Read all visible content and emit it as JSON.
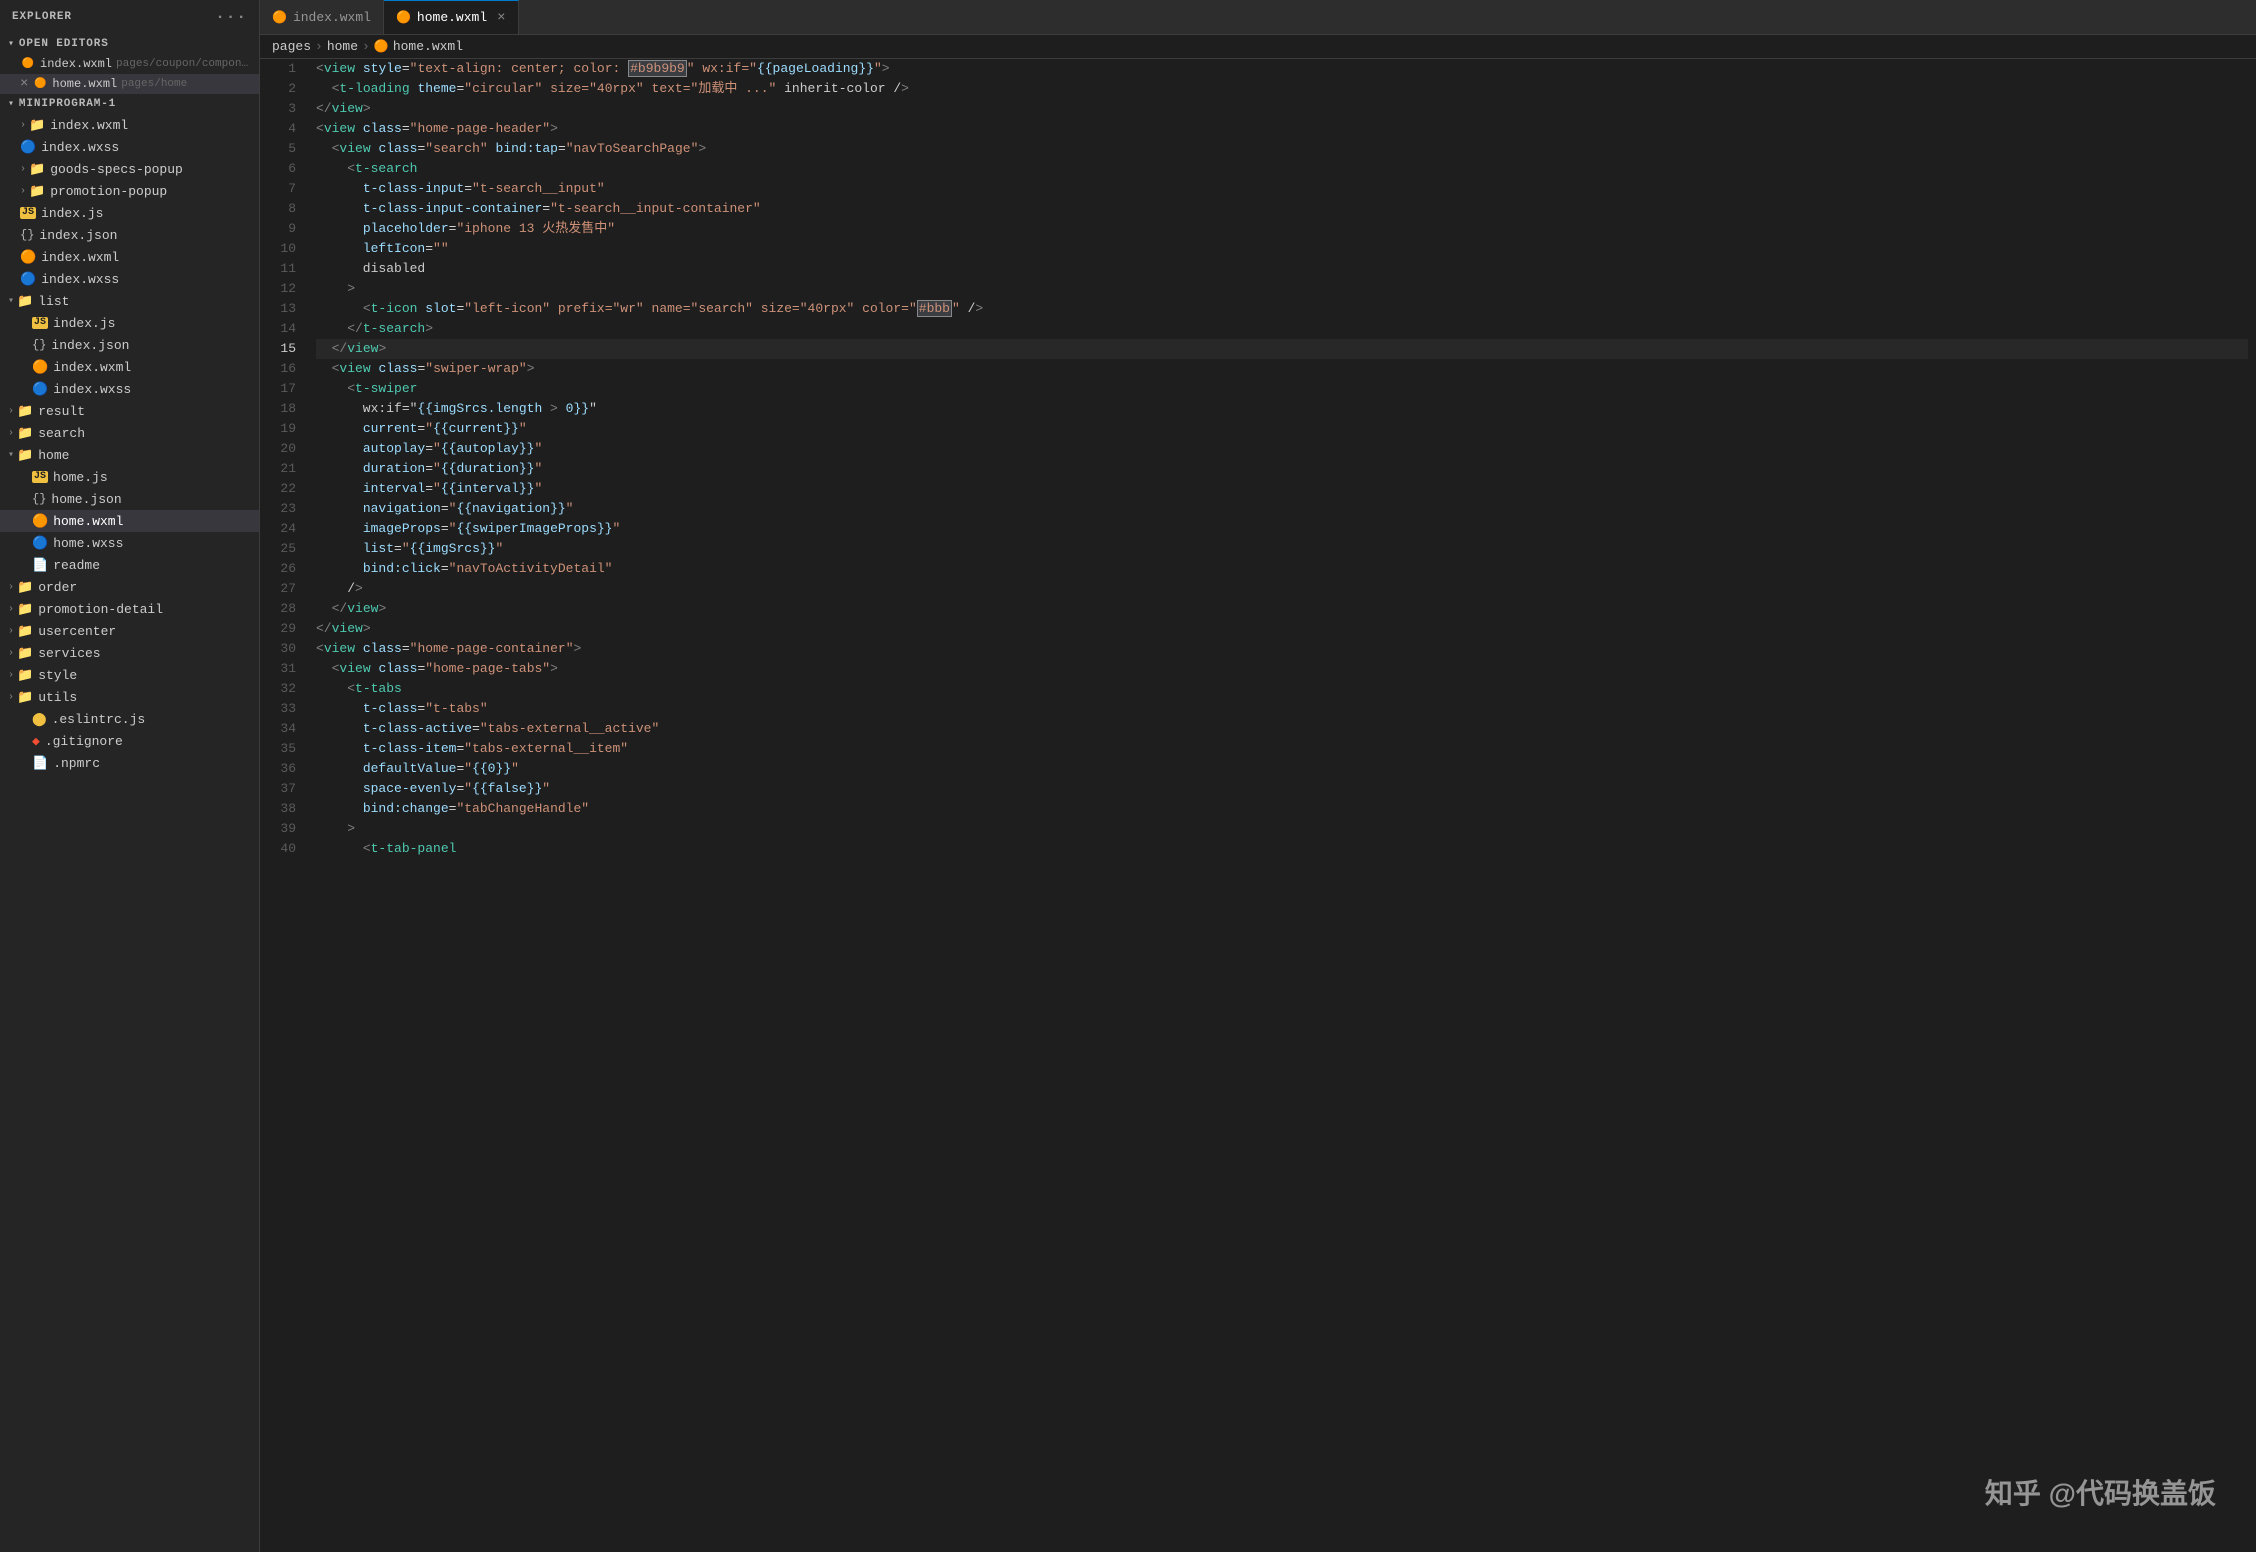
{
  "sidebar": {
    "title": "EXPLORER",
    "open_editors_label": "OPEN EDITORS",
    "project_label": "MINIPROGRAM-1",
    "open_editors": [
      {
        "name": "index.wxml",
        "path": "pages/coupon/components/floa...",
        "icon": "wxml",
        "active": false
      },
      {
        "name": "home.wxml",
        "path": "pages/home",
        "icon": "wxml",
        "active": true,
        "closeable": true
      }
    ],
    "tree": [
      {
        "indent": 0,
        "type": "folder",
        "label": "index.wxml",
        "expanded": false,
        "level": 1
      },
      {
        "indent": 0,
        "type": "file-wxss",
        "label": "index.wxss",
        "level": 1
      },
      {
        "indent": 0,
        "type": "folder",
        "label": "goods-specs-popup",
        "expanded": false,
        "level": 1
      },
      {
        "indent": 0,
        "type": "folder",
        "label": "promotion-popup",
        "expanded": false,
        "level": 1
      },
      {
        "indent": 0,
        "type": "file-js",
        "label": "index.js",
        "level": 1
      },
      {
        "indent": 0,
        "type": "file-json",
        "label": "index.json",
        "level": 1
      },
      {
        "indent": 0,
        "type": "file-wxml",
        "label": "index.wxml",
        "level": 1
      },
      {
        "indent": 0,
        "type": "file-wxss",
        "label": "index.wxss",
        "level": 1
      },
      {
        "indent": 0,
        "type": "folder",
        "label": "list",
        "expanded": true,
        "level": 0
      },
      {
        "indent": 1,
        "type": "file-js",
        "label": "index.js",
        "level": 2
      },
      {
        "indent": 1,
        "type": "file-json",
        "label": "index.json",
        "level": 2
      },
      {
        "indent": 1,
        "type": "file-wxml",
        "label": "index.wxml",
        "level": 2
      },
      {
        "indent": 1,
        "type": "file-wxss",
        "label": "index.wxss",
        "level": 2
      },
      {
        "indent": 0,
        "type": "folder",
        "label": "result",
        "expanded": false,
        "level": 0
      },
      {
        "indent": 0,
        "type": "folder",
        "label": "search",
        "expanded": false,
        "level": 0
      },
      {
        "indent": 0,
        "type": "folder",
        "label": "home",
        "expanded": true,
        "level": 0
      },
      {
        "indent": 1,
        "type": "file-js",
        "label": "home.js",
        "level": 2
      },
      {
        "indent": 1,
        "type": "file-json",
        "label": "home.json",
        "level": 2
      },
      {
        "indent": 1,
        "type": "file-wxml-active",
        "label": "home.wxml",
        "level": 2,
        "active": true
      },
      {
        "indent": 1,
        "type": "file-wxss",
        "label": "home.wxss",
        "level": 2
      },
      {
        "indent": 1,
        "type": "file-txt",
        "label": "readme",
        "level": 2
      },
      {
        "indent": 0,
        "type": "folder",
        "label": "order",
        "expanded": false,
        "level": 0
      },
      {
        "indent": 0,
        "type": "folder",
        "label": "promotion-detail",
        "expanded": false,
        "level": 0
      },
      {
        "indent": 0,
        "type": "folder",
        "label": "usercenter",
        "expanded": false,
        "level": 0
      },
      {
        "indent": 0,
        "type": "folder",
        "label": "services",
        "expanded": false,
        "level": 0
      },
      {
        "indent": 0,
        "type": "folder",
        "label": "style",
        "expanded": false,
        "level": 0
      },
      {
        "indent": 0,
        "type": "folder",
        "label": "utils",
        "expanded": false,
        "level": 0
      },
      {
        "indent": 1,
        "type": "file-eslint",
        "label": ".eslintrc.js",
        "level": 2
      },
      {
        "indent": 1,
        "type": "file-git",
        "label": ".gitignore",
        "level": 2
      },
      {
        "indent": 1,
        "type": "file-npm",
        "label": ".npmrc",
        "level": 2
      }
    ]
  },
  "tabs": [
    {
      "label": "index.wxml",
      "icon": "wxml",
      "active": false
    },
    {
      "label": "home.wxml",
      "icon": "wxml",
      "active": true,
      "closeable": true
    }
  ],
  "breadcrumb": [
    "pages",
    "home",
    "home.wxml"
  ],
  "watermark": "知乎 @代码换盖饭",
  "lines": [
    {
      "num": 1,
      "content": "<view style=\"text-align: center; color: #b9b9b9\" wx:if=\"{{pageLoading}}\">",
      "active": false
    },
    {
      "num": 2,
      "content": "  <t-loading theme=\"circular\" size=\"40rpx\" text=\"加载中 ...\" inherit-color />",
      "active": false
    },
    {
      "num": 3,
      "content": "</view>",
      "active": false
    },
    {
      "num": 4,
      "content": "<view class=\"home-page-header\">",
      "active": false
    },
    {
      "num": 5,
      "content": "  <view class=\"search\" bind:tap=\"navToSearchPage\">",
      "active": false
    },
    {
      "num": 6,
      "content": "    <t-search",
      "active": false
    },
    {
      "num": 7,
      "content": "      t-class-input=\"t-search__input\"",
      "active": false
    },
    {
      "num": 8,
      "content": "      t-class-input-container=\"t-search__input-container\"",
      "active": false
    },
    {
      "num": 9,
      "content": "      placeholder=\"iphone 13 火热发售中\"",
      "active": false
    },
    {
      "num": 10,
      "content": "      leftIcon=\"\"",
      "active": false
    },
    {
      "num": 11,
      "content": "      disabled",
      "active": false
    },
    {
      "num": 12,
      "content": "    >",
      "active": false
    },
    {
      "num": 13,
      "content": "      <t-icon slot=\"left-icon\" prefix=\"wr\" name=\"search\" size=\"40rpx\" color=\"#bbb\" />",
      "active": false
    },
    {
      "num": 14,
      "content": "    </t-search>",
      "active": false
    },
    {
      "num": 15,
      "content": "  </view>",
      "active": true
    },
    {
      "num": 16,
      "content": "  <view class=\"swiper-wrap\">",
      "active": false
    },
    {
      "num": 17,
      "content": "    <t-swiper",
      "active": false
    },
    {
      "num": 18,
      "content": "      wx:if=\"{{imgSrcs.length > 0}}\"",
      "active": false
    },
    {
      "num": 19,
      "content": "      current=\"{{current}}\"",
      "active": false
    },
    {
      "num": 20,
      "content": "      autoplay=\"{{autoplay}}\"",
      "active": false
    },
    {
      "num": 21,
      "content": "      duration=\"{{duration}}\"",
      "active": false
    },
    {
      "num": 22,
      "content": "      interval=\"{{interval}}\"",
      "active": false
    },
    {
      "num": 23,
      "content": "      navigation=\"{{navigation}}\"",
      "active": false
    },
    {
      "num": 24,
      "content": "      imageProps=\"{{swiperImageProps}}\"",
      "active": false
    },
    {
      "num": 25,
      "content": "      list=\"{{imgSrcs}}\"",
      "active": false
    },
    {
      "num": 26,
      "content": "      bind:click=\"navToActivityDetail\"",
      "active": false
    },
    {
      "num": 27,
      "content": "    />",
      "active": false
    },
    {
      "num": 28,
      "content": "  </view>",
      "active": false
    },
    {
      "num": 29,
      "content": "</view>",
      "active": false
    },
    {
      "num": 30,
      "content": "<view class=\"home-page-container\">",
      "active": false
    },
    {
      "num": 31,
      "content": "  <view class=\"home-page-tabs\">",
      "active": false
    },
    {
      "num": 32,
      "content": "    <t-tabs",
      "active": false
    },
    {
      "num": 33,
      "content": "      t-class=\"t-tabs\"",
      "active": false
    },
    {
      "num": 34,
      "content": "      t-class-active=\"tabs-external__active\"",
      "active": false
    },
    {
      "num": 35,
      "content": "      t-class-item=\"tabs-external__item\"",
      "active": false
    },
    {
      "num": 36,
      "content": "      defaultValue=\"{{0}}\"",
      "active": false
    },
    {
      "num": 37,
      "content": "      space-evenly=\"{{false}}\"",
      "active": false
    },
    {
      "num": 38,
      "content": "      bind:change=\"tabChangeHandle\"",
      "active": false
    },
    {
      "num": 39,
      "content": "    >",
      "active": false
    },
    {
      "num": 40,
      "content": "      <t-tab-panel",
      "active": false
    }
  ]
}
